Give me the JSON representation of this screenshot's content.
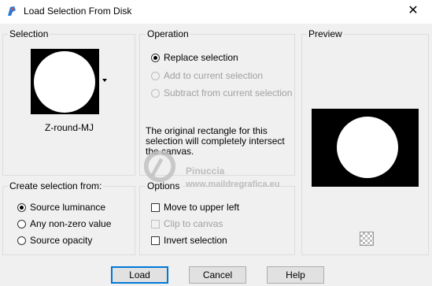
{
  "window": {
    "title": "Load Selection From Disk"
  },
  "selection_group": {
    "label": "Selection",
    "file_name": "Z-round-MJ"
  },
  "operation_group": {
    "label": "Operation",
    "options": [
      {
        "label": "Replace selection",
        "selected": true,
        "enabled": true
      },
      {
        "label": "Add to current selection",
        "selected": false,
        "enabled": false
      },
      {
        "label": "Subtract from current selection",
        "selected": false,
        "enabled": false
      }
    ],
    "note": "The original rectangle for this selection will completely intersect the canvas."
  },
  "preview_group": {
    "label": "Preview"
  },
  "create_group": {
    "label": "Create selection from:",
    "options": [
      {
        "label": "Source luminance",
        "selected": true
      },
      {
        "label": "Any non-zero value",
        "selected": false
      },
      {
        "label": "Source opacity",
        "selected": false
      }
    ]
  },
  "options_group": {
    "label": "Options",
    "checks": [
      {
        "label": "Move to upper left",
        "checked": false,
        "enabled": true
      },
      {
        "label": "Clip to canvas",
        "checked": false,
        "enabled": false
      },
      {
        "label": "Invert selection",
        "checked": false,
        "enabled": true
      }
    ]
  },
  "buttons": {
    "load": "Load",
    "cancel": "Cancel",
    "help": "Help"
  },
  "watermark": {
    "name": "Pinuccia",
    "site": "www.maildregrafica.eu"
  },
  "colors": {
    "accent": "#0078d7",
    "preview_bg": "#000000",
    "circle": "#ffffff"
  }
}
